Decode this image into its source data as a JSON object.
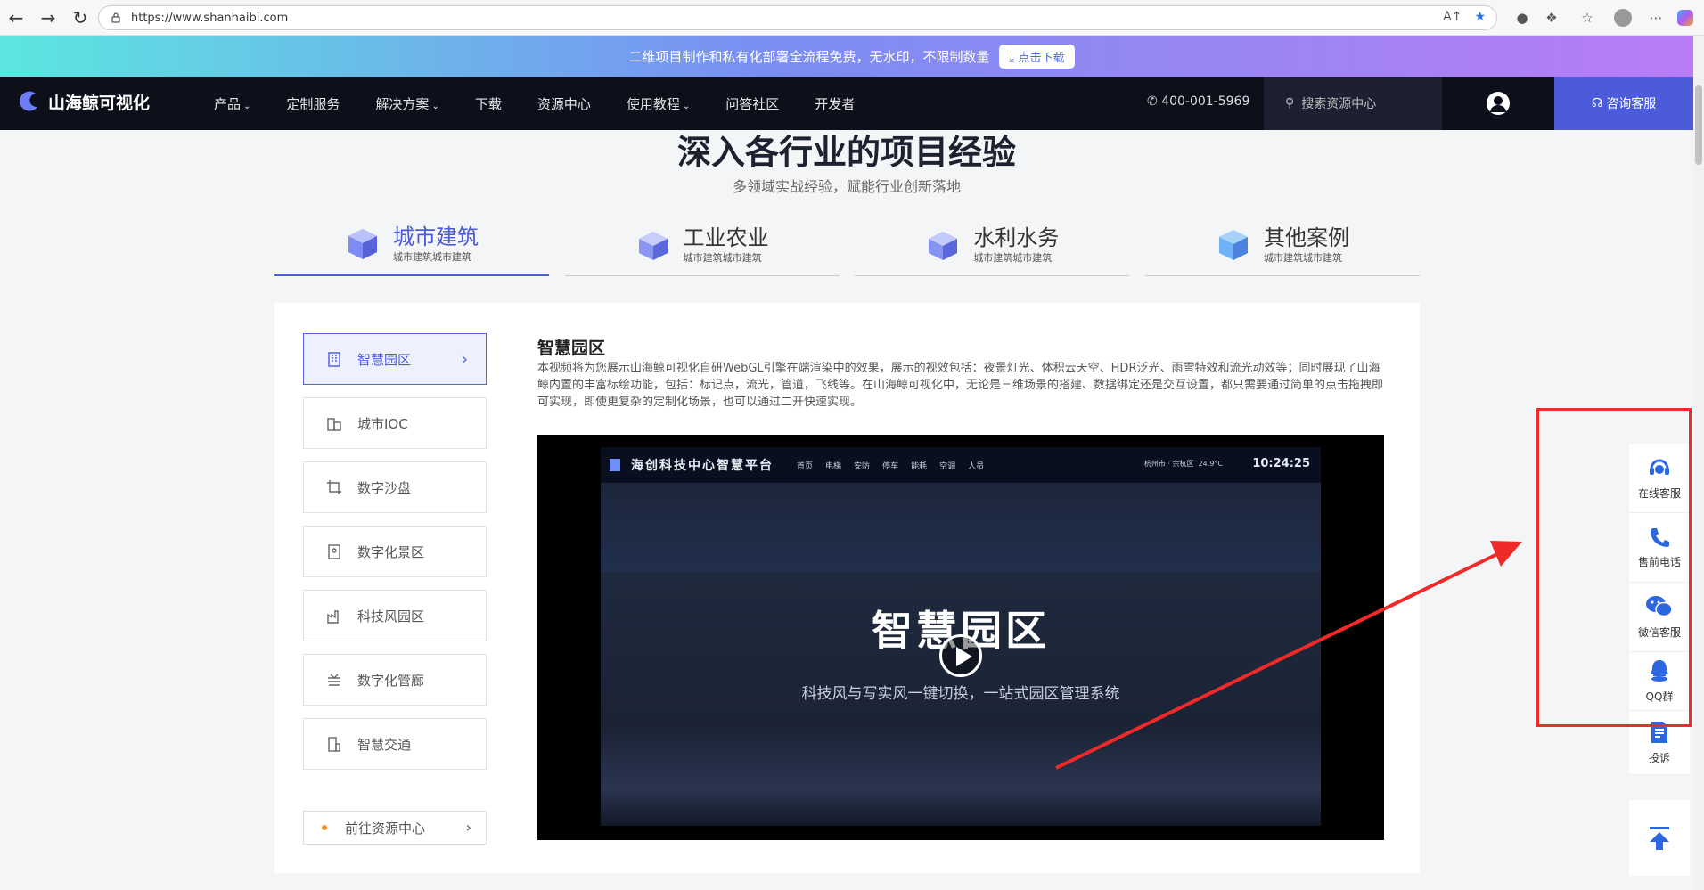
{
  "browser": {
    "url": "https://www.shanhaibi.com"
  },
  "promo": {
    "text": "二维项目制作和私有化部署全流程免费，无水印，不限制数量",
    "download_label": "点击下载"
  },
  "header": {
    "logo_text": "山海鲸可视化",
    "nav": [
      {
        "label": "产品",
        "has_menu": true
      },
      {
        "label": "定制服务",
        "has_menu": false
      },
      {
        "label": "解决方案",
        "has_menu": true
      },
      {
        "label": "下载",
        "has_menu": false
      },
      {
        "label": "资源中心",
        "has_menu": false
      },
      {
        "label": "使用教程",
        "has_menu": true
      },
      {
        "label": "问答社区",
        "has_menu": false
      },
      {
        "label": "开发者",
        "has_menu": false
      }
    ],
    "phone": "400-001-5969",
    "search_placeholder": "搜索资源中心",
    "consult_label": "咨询客服"
  },
  "section": {
    "title": "深入各行业的项目经验",
    "subtitle": "多领域实战经验，赋能行业创新落地"
  },
  "categories": [
    {
      "title": "城市建筑",
      "sub": "城市建筑城市建筑",
      "active": true
    },
    {
      "title": "工业农业",
      "sub": "城市建筑城市建筑",
      "active": false
    },
    {
      "title": "水利水务",
      "sub": "城市建筑城市建筑",
      "active": false
    },
    {
      "title": "其他案例",
      "sub": "城市建筑城市建筑",
      "active": false
    }
  ],
  "sidebar": {
    "items": [
      {
        "label": "智慧园区",
        "active": true
      },
      {
        "label": "城市IOC",
        "active": false
      },
      {
        "label": "数字沙盘",
        "active": false
      },
      {
        "label": "数字化景区",
        "active": false
      },
      {
        "label": "科技风园区",
        "active": false
      },
      {
        "label": "数字化管廊",
        "active": false
      },
      {
        "label": "智慧交通",
        "active": false
      }
    ],
    "goto_label": "前往资源中心"
  },
  "detail": {
    "title": "智慧园区",
    "description": "本视频将为您展示山海鲸可视化自研WebGL引擎在端渲染中的效果，展示的视效包括：夜景灯光、体积云天空、HDR泛光、雨雪特效和流光动效等；同时展现了山海鲸内置的丰富标绘功能，包括：标记点，流光，管道，飞线等。在山海鲸可视化中，无论是三维场景的搭建、数据绑定还是交互设置，都只需要通过简单的点击拖拽即可实现，即使更复杂的定制化场景，也可以通过二开快速实现。"
  },
  "video": {
    "platform_title": "海创科技中心智慧平台",
    "menu": [
      "首页",
      "电梯",
      "安防",
      "停车",
      "能耗",
      "空调",
      "人员"
    ],
    "location": "杭州市 · 余杭区",
    "temperature": "24.9°C",
    "clock": "10:24:25",
    "big_title": "智慧园区",
    "subtitle": "科技风与写实风一键切换，一站式园区管理系统"
  },
  "float_panel": {
    "items": [
      {
        "label": "在线客服",
        "icon": "headset-icon"
      },
      {
        "label": "售前电话",
        "icon": "phone-icon"
      },
      {
        "label": "微信客服",
        "icon": "wechat-icon"
      },
      {
        "label": "QQ群",
        "icon": "qq-icon"
      },
      {
        "label": "投诉",
        "icon": "complaint-icon"
      }
    ]
  },
  "colors": {
    "accent": "#4b5bd9",
    "annotation": "#f02929",
    "header_bg": "#0d0f1a"
  }
}
